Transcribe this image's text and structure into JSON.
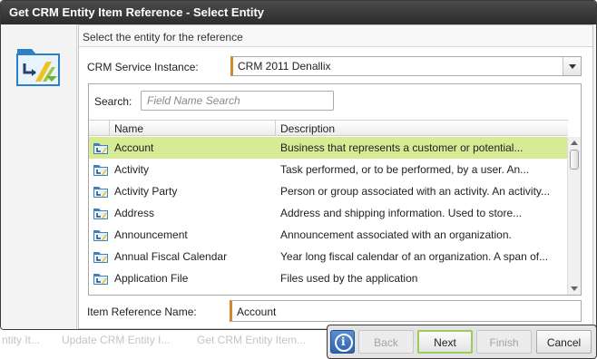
{
  "window": {
    "title": "Get CRM Entity Item Reference - Select Entity"
  },
  "section": {
    "header": "Select the entity for the reference"
  },
  "service": {
    "label": "CRM Service Instance:",
    "value": "CRM 2011 Denallix"
  },
  "search": {
    "label": "Search:",
    "placeholder": "Field Name Search"
  },
  "grid": {
    "columns": {
      "name": "Name",
      "description": "Description"
    },
    "rows": [
      {
        "name": "Account",
        "description": "Business that represents a customer or potential...",
        "selected": true
      },
      {
        "name": "Activity",
        "description": "Task performed, or to be performed, by a user. An...",
        "selected": false
      },
      {
        "name": "Activity Party",
        "description": "Person or group associated with an activity. An activity...",
        "selected": false
      },
      {
        "name": "Address",
        "description": "Address and shipping information. Used to store...",
        "selected": false
      },
      {
        "name": "Announcement",
        "description": "Announcement associated with an organization.",
        "selected": false
      },
      {
        "name": "Annual Fiscal Calendar",
        "description": "Year long fiscal calendar of an organization. A span of...",
        "selected": false
      },
      {
        "name": "Application File",
        "description": "Files used by the application",
        "selected": false
      }
    ]
  },
  "reference": {
    "label": "Item Reference Name:",
    "value": "Account"
  },
  "taskbar": {
    "crumbs": [
      "ntity It...",
      "Update CRM Entity I...",
      "Get CRM Entity Item..."
    ]
  },
  "buttons": {
    "info": "i",
    "back": "Back",
    "next": "Next",
    "finish": "Finish",
    "cancel": "Cancel"
  },
  "colors": {
    "selected_row": "#d7eb95",
    "accent_border": "#d08a2a",
    "titlebar": "#3a3a3a"
  }
}
